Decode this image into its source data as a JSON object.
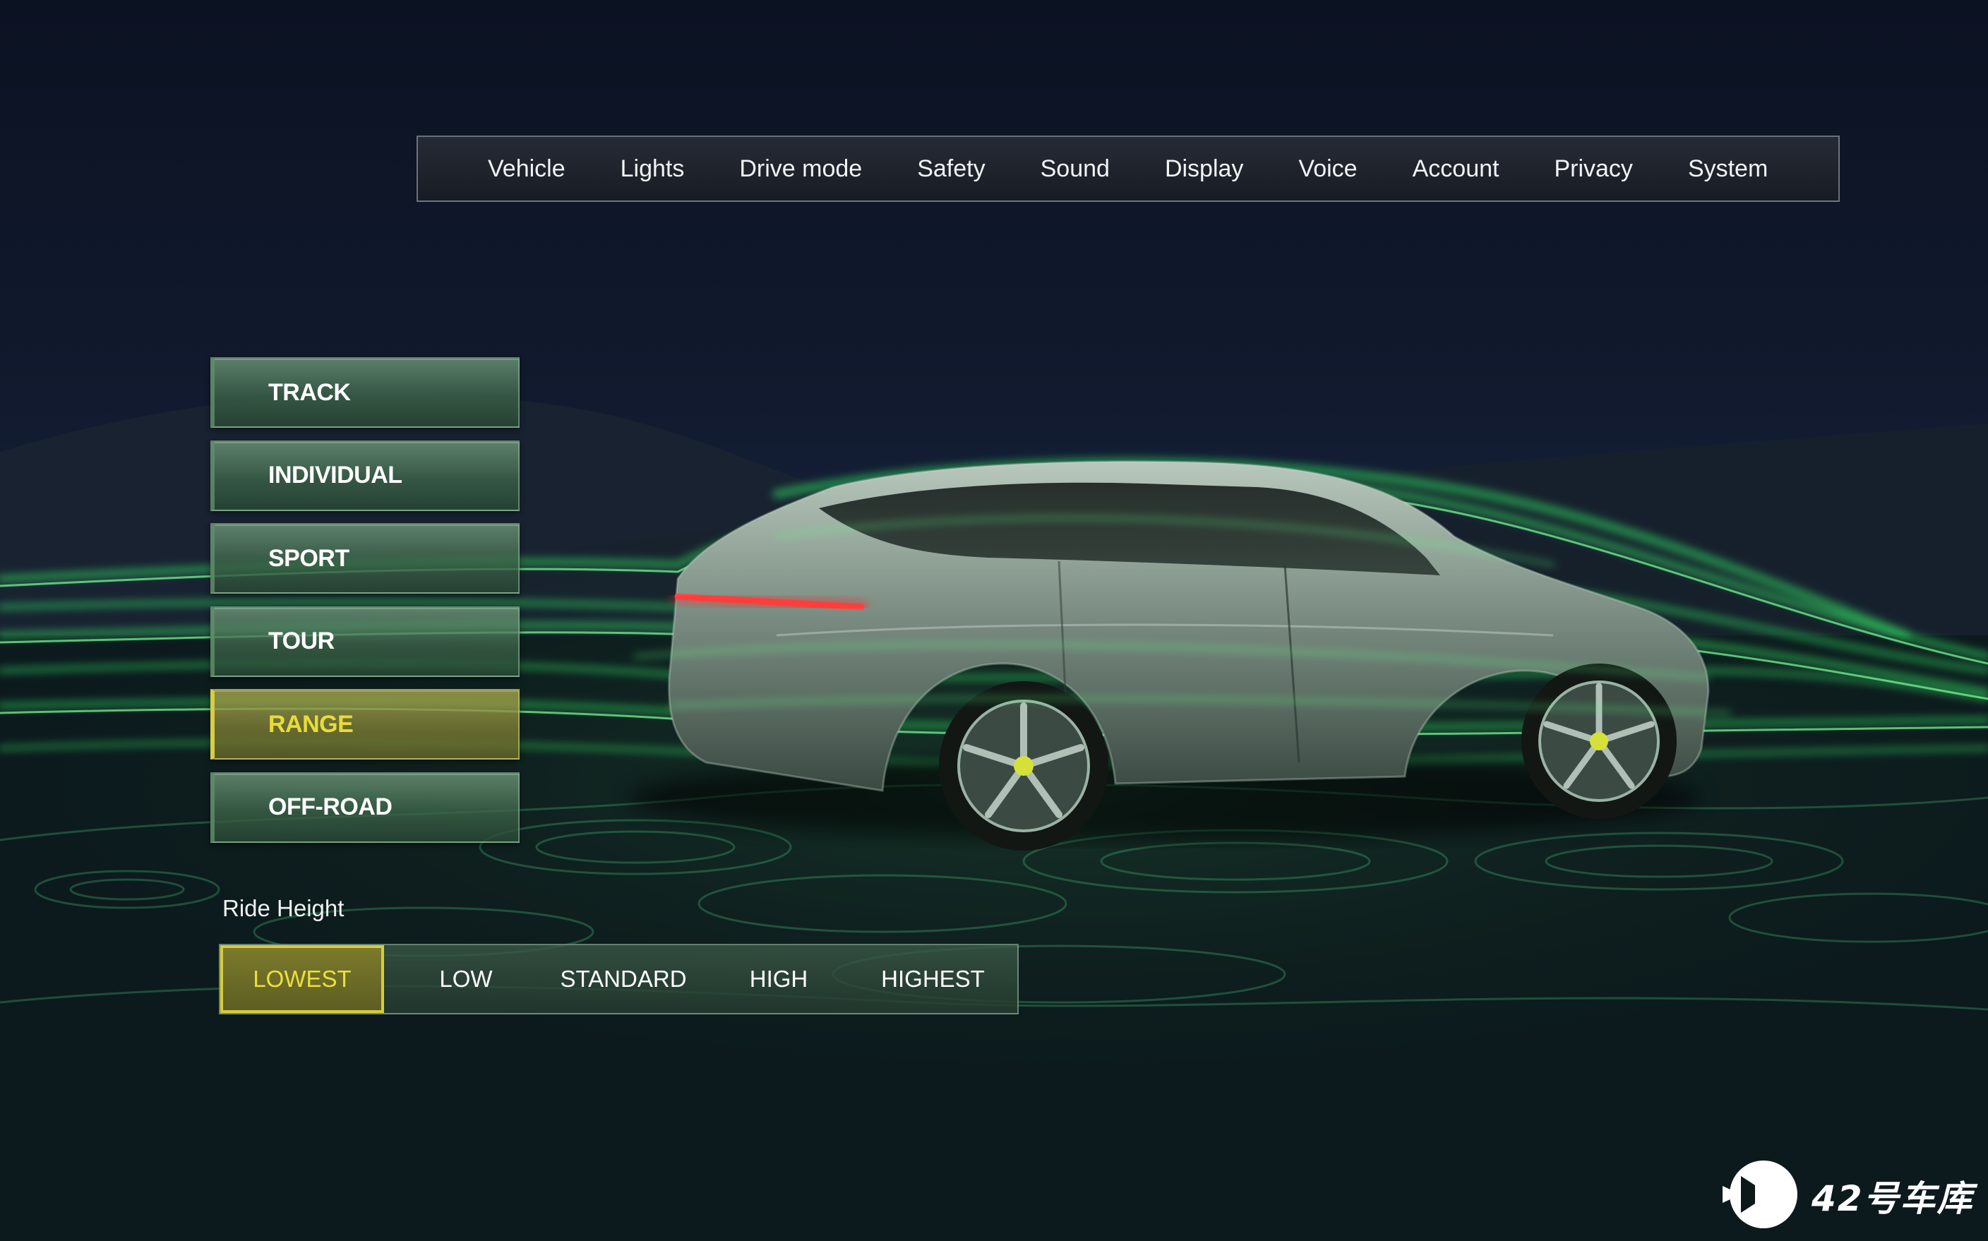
{
  "top_nav": {
    "tabs": [
      {
        "label": "Vehicle"
      },
      {
        "label": "Lights"
      },
      {
        "label": "Drive mode"
      },
      {
        "label": "Safety"
      },
      {
        "label": "Sound"
      },
      {
        "label": "Display"
      },
      {
        "label": "Voice"
      },
      {
        "label": "Account"
      },
      {
        "label": "Privacy"
      },
      {
        "label": "System"
      }
    ]
  },
  "drive_modes": {
    "items": [
      {
        "label": "TRACK"
      },
      {
        "label": "INDIVIDUAL"
      },
      {
        "label": "SPORT"
      },
      {
        "label": "TOUR"
      },
      {
        "label": "RANGE"
      },
      {
        "label": "OFF-ROAD"
      }
    ],
    "selected": "RANGE"
  },
  "ride_height": {
    "title": "Ride Height",
    "options": [
      {
        "label": "LOWEST"
      },
      {
        "label": "LOW"
      },
      {
        "label": "STANDARD"
      },
      {
        "label": "HIGH"
      },
      {
        "label": "HIGHEST"
      }
    ],
    "selected": "LOWEST"
  },
  "watermark": {
    "text": "42号车库"
  },
  "colors": {
    "accent_yellow": "#e8dc3a",
    "mode_green": "#3e664a",
    "glow_green": "#3cff6a",
    "background": "#0b1320"
  }
}
